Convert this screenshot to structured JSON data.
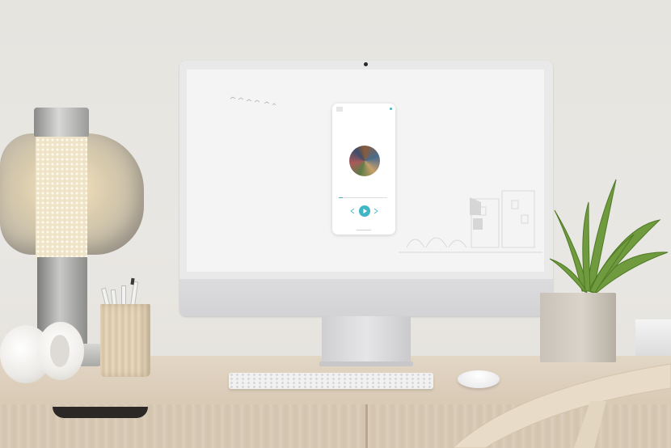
{
  "scene": "desk-with-imac",
  "screen_app": {
    "title": "",
    "subtitle": "",
    "track_name": "",
    "artist": "",
    "progress": 0.08,
    "icons": {
      "menu": "menu-icon",
      "prev": "previous-icon",
      "play": "play-icon",
      "next": "next-icon"
    },
    "accent": "#3fb5c5"
  }
}
